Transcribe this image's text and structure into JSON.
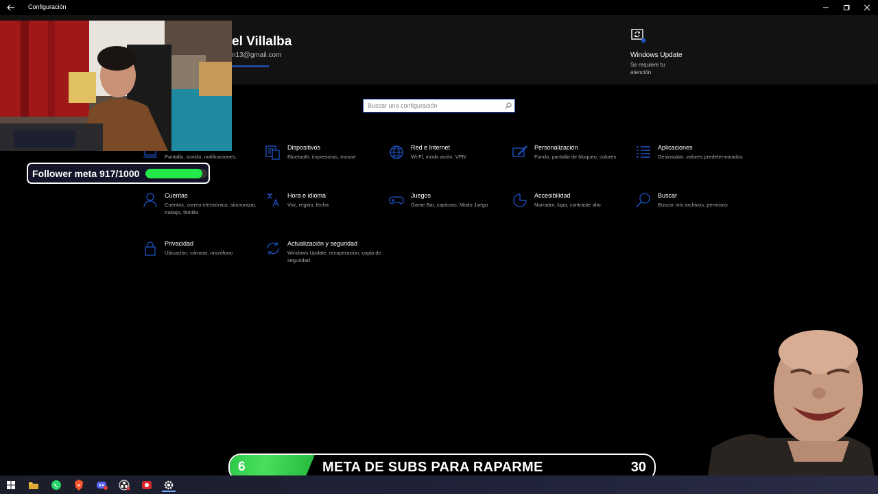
{
  "window": {
    "title": "Configuración",
    "back_icon": "arrow-left-icon",
    "controls": [
      "minimize-icon",
      "maximize-icon",
      "close-icon"
    ]
  },
  "header": {
    "user_name": "el Villalba",
    "email": "n13@gmail.com",
    "windows_update": {
      "icon": "sync-icon",
      "title": "Windows Update",
      "subtitle": "Se requiere tu atención"
    }
  },
  "search": {
    "placeholder": "Buscar una configuración",
    "icon": "search-icon"
  },
  "categories": [
    {
      "title": "",
      "desc": "Pantalla, sonido, notificaciones,",
      "icon": "laptop-icon"
    },
    {
      "title": "Dispositivos",
      "desc": "Bluetooth, impresoras, mouse",
      "icon": "keyboard-icon"
    },
    {
      "title": "Red e Internet",
      "desc": "Wi-Fi, modo avión, VPN",
      "icon": "globe-icon"
    },
    {
      "title": "Personalización",
      "desc": "Fondo, pantalla de bloqueo, colores",
      "icon": "paintbrush-icon"
    },
    {
      "title": "Aplicaciones",
      "desc": "Desinstalar, valores predeterminados",
      "icon": "list-icon"
    },
    {
      "title": "Cuentas",
      "desc": "Cuentas, correo electrónico, sincronizar, trabajo, familia",
      "icon": "person-icon"
    },
    {
      "title": "Hora e idioma",
      "desc": "Voz, región, fecha",
      "icon": "clock-language-icon"
    },
    {
      "title": "Juegos",
      "desc": "Game Bar, capturas, Modo Juego",
      "icon": "gamepad-icon"
    },
    {
      "title": "Accesibilidad",
      "desc": "Narrador, lupa, contraste alto",
      "icon": "accessibility-icon"
    },
    {
      "title": "Buscar",
      "desc": "Buscar mis archivos, permisos",
      "icon": "search-icon"
    },
    {
      "title": "Privacidad",
      "desc": "Ubicación, cámara, micrófono",
      "icon": "lock-icon"
    },
    {
      "title": "Actualización y seguridad",
      "desc": "Windows Update, recuperación, copia de seguridad",
      "icon": "sync-icon"
    }
  ],
  "overlays": {
    "follower_goal": {
      "label": "Follower meta 917/1000",
      "current": 917,
      "target": 1000,
      "color": "#22e84a"
    },
    "subs_goal": {
      "current": "6",
      "label": "META DE SUBS PARA RAPARME",
      "target": "30",
      "progress": 0.2,
      "color": "#2ec94a"
    }
  },
  "taskbar": {
    "items": [
      {
        "name": "start-icon",
        "active": false
      },
      {
        "name": "file-explorer-icon",
        "active": false
      },
      {
        "name": "whatsapp-icon",
        "active": false
      },
      {
        "name": "brave-icon",
        "active": false
      },
      {
        "name": "discord-icon",
        "active": false
      },
      {
        "name": "obs-icon",
        "active": false
      },
      {
        "name": "recorder-icon",
        "active": false
      },
      {
        "name": "settings-icon",
        "active": true
      }
    ]
  },
  "colors": {
    "accent": "#1f55c8",
    "header_bg": "#121212",
    "page_bg": "#000000"
  }
}
